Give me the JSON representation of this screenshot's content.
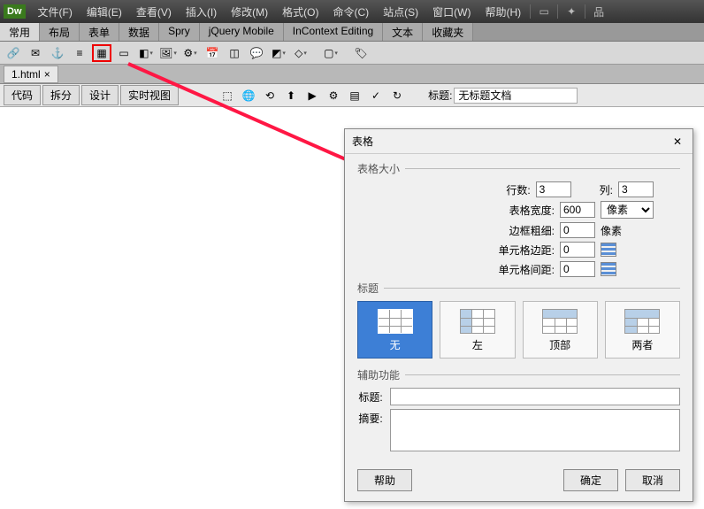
{
  "menubar": {
    "items": [
      "文件(F)",
      "编辑(E)",
      "查看(V)",
      "插入(I)",
      "修改(M)",
      "格式(O)",
      "命令(C)",
      "站点(S)",
      "窗口(W)",
      "帮助(H)"
    ]
  },
  "tabbar": {
    "items": [
      "常用",
      "布局",
      "表单",
      "数据",
      "Spry",
      "jQuery Mobile",
      "InContext Editing",
      "文本",
      "收藏夹"
    ],
    "active": 0
  },
  "filetab": {
    "name": "1.html"
  },
  "viewbar": {
    "buttons": [
      "代码",
      "拆分",
      "设计",
      "实时视图"
    ],
    "title_label": "标题:",
    "title_value": "无标题文档"
  },
  "dialog": {
    "title": "表格",
    "section_size": "表格大小",
    "rows_label": "行数:",
    "rows_value": "3",
    "cols_label": "列:",
    "cols_value": "3",
    "width_label": "表格宽度:",
    "width_value": "600",
    "width_unit": "像素",
    "border_label": "边框粗细:",
    "border_value": "0",
    "border_unit": "像素",
    "cellpad_label": "单元格边距:",
    "cellpad_value": "0",
    "cellspace_label": "单元格间距:",
    "cellspace_value": "0",
    "section_header": "标题",
    "header_options": [
      "无",
      "左",
      "顶部",
      "两者"
    ],
    "header_selected": 0,
    "section_acc": "辅助功能",
    "caption_label": "标题:",
    "summary_label": "摘要:",
    "buttons": {
      "help": "帮助",
      "ok": "确定",
      "cancel": "取消"
    }
  }
}
